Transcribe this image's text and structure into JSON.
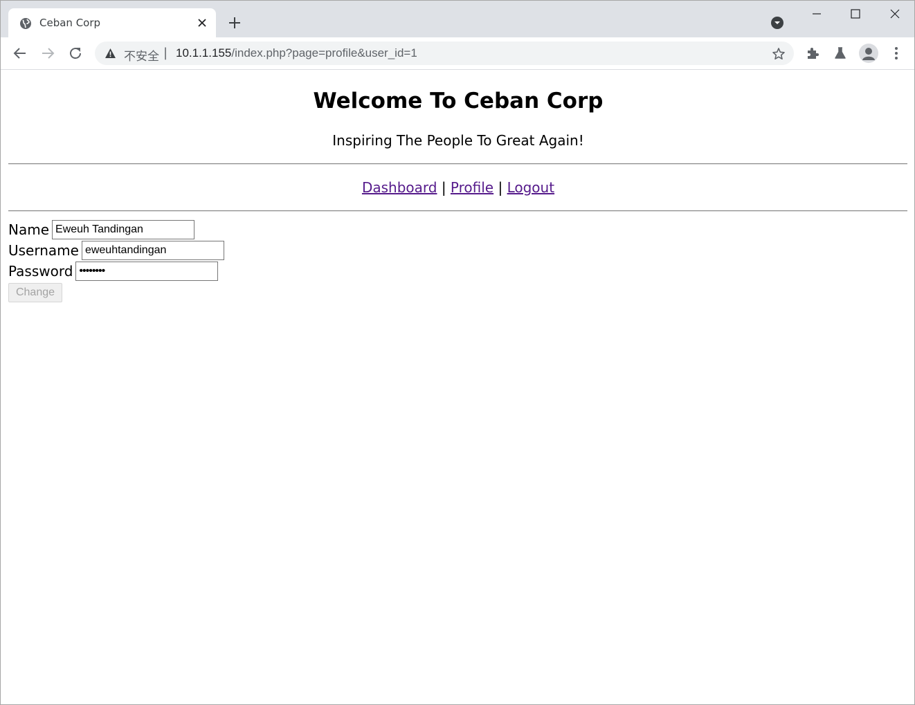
{
  "browser": {
    "tab": {
      "title": "Ceban Corp"
    },
    "address_bar": {
      "security_label": "不安全",
      "separator": "|",
      "host": "10.1.1.155",
      "path": "/index.php?page=profile&user_id=1"
    }
  },
  "page": {
    "heading": "Welcome To Ceban Corp",
    "tagline": "Inspiring The People To Great Again!",
    "nav": {
      "dashboard": "Dashboard",
      "profile": "Profile",
      "logout": "Logout",
      "separator": "|"
    },
    "form": {
      "name_label": "Name",
      "name_value": "Eweuh Tandingan",
      "username_label": "Username",
      "username_value": "eweuhtandingan",
      "password_label": "Password",
      "password_value": "••••••••",
      "submit_label": "Change"
    }
  },
  "colors": {
    "visited_link": "#551a8b",
    "tabstrip_bg": "#dee1e6",
    "omnibox_bg": "#f1f3f4"
  }
}
